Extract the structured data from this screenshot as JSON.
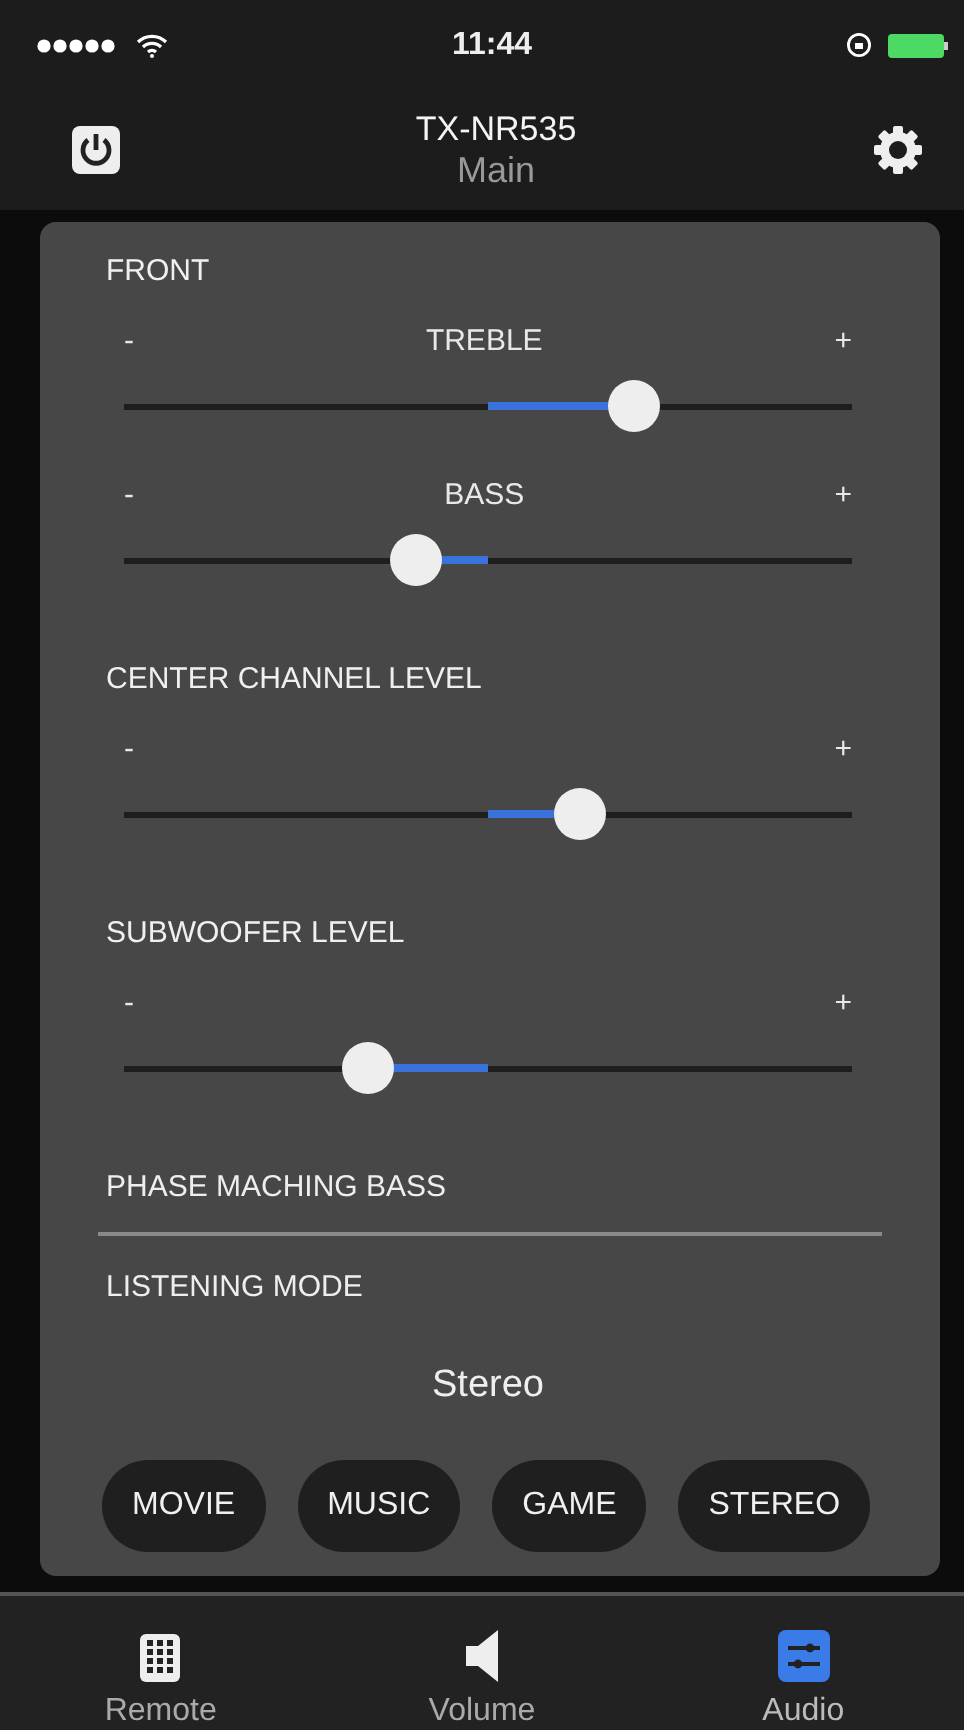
{
  "status_bar": {
    "time": "11:44"
  },
  "header": {
    "title": "TX-NR535",
    "subtitle": "Main"
  },
  "sections": [
    {
      "title": "FRONT",
      "sliders": [
        {
          "label": "TREBLE",
          "minus": "-",
          "plus": "+",
          "level": 0.7
        },
        {
          "label": "BASS",
          "minus": "-",
          "plus": "+",
          "level": 0.4
        }
      ]
    },
    {
      "title": "CENTER CHANNEL LEVEL",
      "sliders": [
        {
          "minus": "-",
          "plus": "+",
          "level": 0.625
        }
      ]
    },
    {
      "title": "SUBWOOFER LEVEL",
      "sliders": [
        {
          "minus": "-",
          "plus": "+",
          "level": 0.335
        }
      ]
    }
  ],
  "phase_matching": {
    "label": "PHASE MACHING BASS"
  },
  "listening_mode": {
    "title": "LISTENING MODE",
    "value": "Stereo",
    "buttons": [
      "MOVIE",
      "MUSIC",
      "GAME",
      "STEREO"
    ]
  },
  "tab_bar": [
    {
      "label": "Remote",
      "kind": "remote",
      "selected": false
    },
    {
      "label": "Volume",
      "kind": "volume",
      "selected": false
    },
    {
      "label": "Audio",
      "kind": "audio",
      "selected": true
    }
  ]
}
